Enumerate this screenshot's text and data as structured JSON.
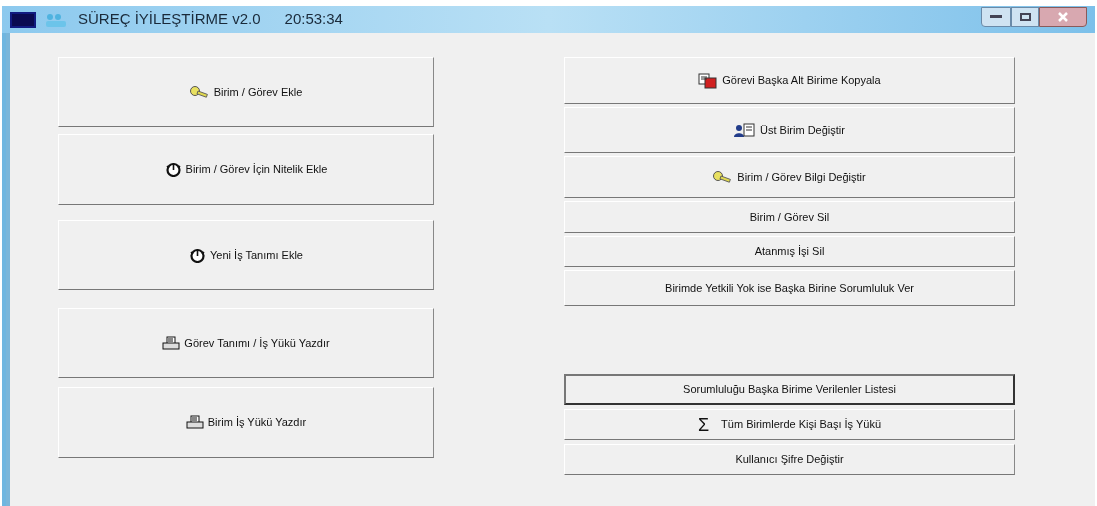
{
  "window": {
    "title": "SÜREÇ İYİLEŞTİRME v2.0",
    "clock": "20:53:34"
  },
  "left_buttons": [
    {
      "label": "Birim / Görev Ekle",
      "kind": "key",
      "focused": false
    },
    {
      "label": "Birim / Görev İçin Nitelik Ekle",
      "kind": "stopwatch",
      "focused": false
    },
    {
      "label": "Yeni İş Tanımı Ekle",
      "kind": "stopwatch",
      "focused": false
    },
    {
      "label": "Görev Tanımı / İş Yükü Yazdır",
      "kind": "printer",
      "focused": false
    },
    {
      "label": "Birim İş Yükü Yazdır",
      "kind": "printer",
      "focused": false
    }
  ],
  "right_buttons": [
    {
      "label": "Görevi Başka Alt Birime Kopyala",
      "kind": "copy",
      "focused": false
    },
    {
      "label": "Üst Birim Değiştir",
      "kind": "people",
      "focused": false
    },
    {
      "label": "Birim / Görev Bilgi Değiştir",
      "kind": "key",
      "focused": false
    },
    {
      "label": "Birim / Görev Sil",
      "focused": false
    },
    {
      "label": "Atanmış İşi Sil",
      "focused": false
    },
    {
      "label": "Birimde Yetkili Yok ise Başka Birine Sorumluluk Ver",
      "focused": false
    }
  ],
  "right_bottom_buttons": [
    {
      "label": "Sorumluluğu Başka Birime Verilenler Listesi",
      "focused": true
    },
    {
      "label": "Tüm Birimlerde Kişi Başı İş Yükü",
      "glyph": "Σ",
      "focused": false
    },
    {
      "label": "Kullanıcı Şifre Değiştir",
      "focused": false
    }
  ]
}
